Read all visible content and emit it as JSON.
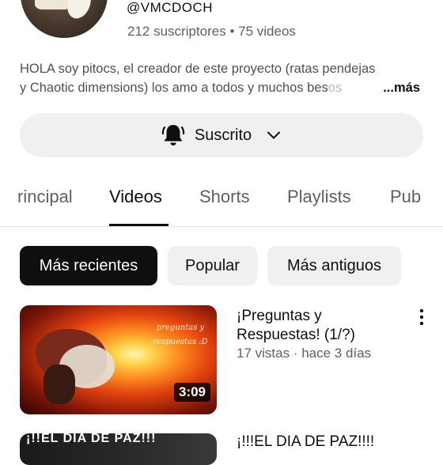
{
  "channel": {
    "handle": "@VMCDOCH",
    "stats": "212 suscriptores • 75 videos",
    "description_line1": "HOLA soy pitocs, el creador de este proyecto (ratas pendejas",
    "description_line2": "y Chaotic dimensions) los amo a todos y muchos bes",
    "description_fade": "os",
    "more_label": "...más"
  },
  "subscribe": {
    "label": "Suscrito",
    "icon": "bell-icon",
    "dropdown_icon": "chevron-down-icon"
  },
  "tabs": [
    {
      "label": "rincipal",
      "active": false
    },
    {
      "label": "Videos",
      "active": true
    },
    {
      "label": "Shorts",
      "active": false
    },
    {
      "label": "Playlists",
      "active": false
    },
    {
      "label": "Pub",
      "active": false
    }
  ],
  "chips": [
    {
      "label": "Más recientes",
      "active": true
    },
    {
      "label": "Popular",
      "active": false
    },
    {
      "label": "Más antiguos",
      "active": false
    }
  ],
  "videos": [
    {
      "title": "¡Preguntas y Respuestas! (1/?)",
      "meta": "17 vistas · hace 3 días",
      "duration": "3:09",
      "thumb_text": "preguntas y respuestas :D"
    },
    {
      "title": "¡!!!EL DIA DE PAZ!!!!",
      "thumb_text": "¡!!EL DIA DE PAZ!!!"
    }
  ],
  "colors": {
    "text": "#0f0f0f",
    "secondary": "#606060",
    "chip_bg": "#f0f0f0",
    "chip_active_bg": "#0f0f0f"
  }
}
